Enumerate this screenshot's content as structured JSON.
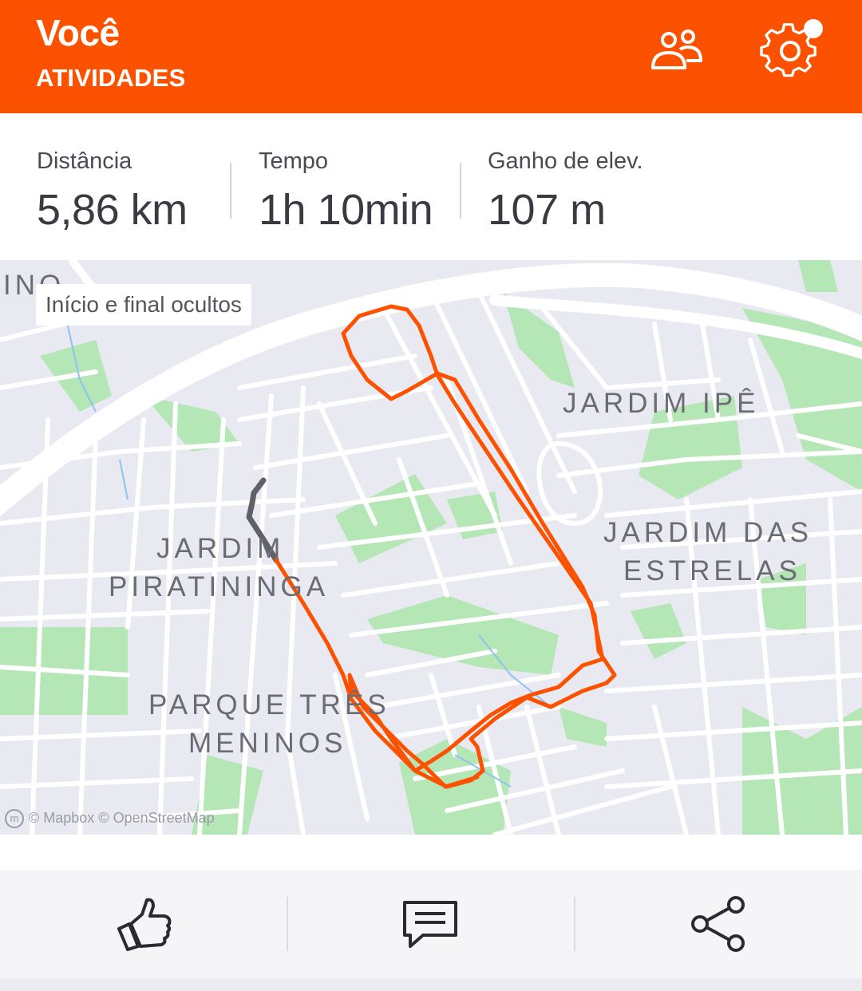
{
  "header": {
    "title": "Você",
    "subtitle": "ATIVIDADES",
    "icons": [
      "friends-icon",
      "settings-icon"
    ],
    "notification_dot": true
  },
  "stats": [
    {
      "label": "Distância",
      "value": "5,86 km"
    },
    {
      "label": "Tempo",
      "value": "1h 10min"
    },
    {
      "label": "Ganho de elev.",
      "value": "107 m"
    }
  ],
  "map": {
    "privacy_notice": "Início e final ocultos",
    "partial_label": "INO",
    "neighborhoods": [
      {
        "name": "JARDIM IPÊ"
      },
      {
        "name": "JARDIM DAS"
      },
      {
        "name": "ESTRELAS"
      },
      {
        "name": "JARDIM"
      },
      {
        "name": "PIRATININGA"
      },
      {
        "name": "PARQUE TRÊS"
      },
      {
        "name": "MENINOS"
      }
    ],
    "attribution": "© Mapbox © OpenStreetMap",
    "route_color": "#fc5200",
    "hidden_segment_color": "#5f6069"
  },
  "actions": [
    {
      "name": "like",
      "icon": "thumbs-up-icon"
    },
    {
      "name": "comment",
      "icon": "comment-icon"
    },
    {
      "name": "share",
      "icon": "share-icon"
    }
  ],
  "colors": {
    "brand": "#fc5200",
    "park": "#b5e6b6",
    "road": "#ffffff",
    "background": "#e9e9f1"
  }
}
